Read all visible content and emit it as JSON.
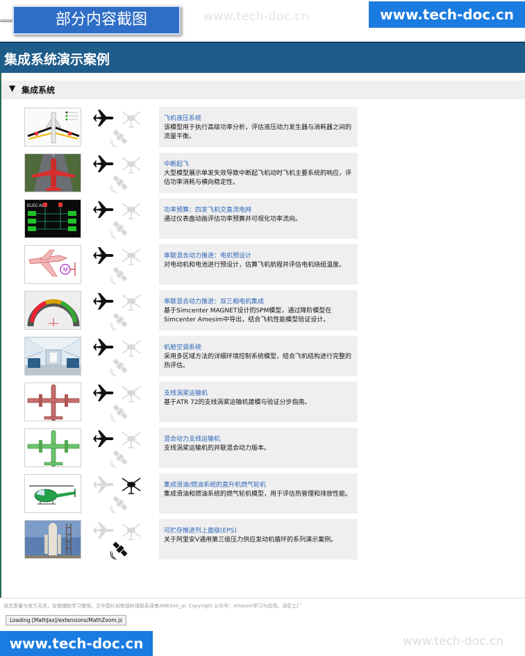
{
  "banner": {
    "badge_label": "部分内容截图",
    "watermark": "www.tech-doc.cn",
    "brand": "www.tech-doc.cn"
  },
  "page": {
    "title": "集成系统演示案例"
  },
  "section": {
    "toggle": "▼",
    "label": "集成系统"
  },
  "rows": [
    {
      "title": "飞机液压系统",
      "text": "该模型用于执行高级功率分析，评估液压动力发生器与消耗器之间的流量平衡。",
      "thumb": "hydraulic-schematic"
    },
    {
      "title": "中断起飞",
      "text": "大型模型展示单发失效导致中断起飞机动时飞机主要系统的响应，评估功率消耗与横向稳定性。",
      "thumb": "red-aircraft-runway"
    },
    {
      "title": "功率预算：四发飞机交直流电网",
      "text": "通过仪表盘动画评估功率预算并可视化功率流向。",
      "thumb": "elec-ac-dashboard"
    },
    {
      "title": "串联混合动力推进：电机预设计",
      "text": "对电动机和电池进行预设计，估算飞机航程并评估电机绕组温度。",
      "thumb": "hybrid-aircraft-motor"
    },
    {
      "title": "串联混合动力推进：双三相电机集成",
      "text": "基于Simcenter MAGNET设计的SPM模型，通过降阶模型在Simcenter Amesim中导出，结合飞机性能模型验证设计。",
      "thumb": "motor-gauge"
    },
    {
      "title": "机舱空调系统",
      "text": "采用多区域方法的详细环境控制系统模型，结合飞机结构进行完整的热评估。",
      "thumb": "cabin-interior"
    },
    {
      "title": "支线涡桨运输机",
      "text": "基于ATR 72的支线涡桨运输机建模与验证分步指南。",
      "thumb": "turboprop-red"
    },
    {
      "title": "混合动力支线运输机",
      "text": "支线涡桨运输机的并联混合动力版本。",
      "thumb": "turboprop-green"
    },
    {
      "title": "集成滑油/燃油系统的直升机燃气轮机",
      "text": "集成滑油和燃油系统的燃气轮机模型，用于评估热管理和排放性能。",
      "thumb": "helicopter"
    },
    {
      "title": "可贮存推进剂上面级(EPS)",
      "text": "关于阿里安V通用第三级压力供应发动机循环的系列演示案例。",
      "thumb": "rocket-launchpad"
    }
  ],
  "footer": {
    "note": "译文质量与官方无关，仅做辅助学习使用。文中图片如有侵权请联系译者AMESim_ai. Copyright 公众号：Amesim学习与应用，译匠工厂",
    "loading": "Loading [MathJax]/extensions/MathZoom.js",
    "brand": "www.tech-doc.cn",
    "watermark": "www.tech-doc.cn"
  },
  "icon_states": [
    [
      "active",
      "faded",
      "faded"
    ],
    [
      "active",
      "faded",
      "faded"
    ],
    [
      "active",
      "faded",
      "faded"
    ],
    [
      "active",
      "faded",
      "faded"
    ],
    [
      "active",
      "faded",
      "faded"
    ],
    [
      "active",
      "faded",
      "faded"
    ],
    [
      "active",
      "faded",
      "faded"
    ],
    [
      "active",
      "faded",
      "faded"
    ],
    [
      "faded",
      "active",
      "faded"
    ],
    [
      "faded",
      "faded",
      "active"
    ]
  ],
  "colors": {
    "heading_bg": "#1e5c8a",
    "brand_blue": "#1a7be0",
    "link_blue": "#2a64b8",
    "panel_gray": "#efefef"
  }
}
